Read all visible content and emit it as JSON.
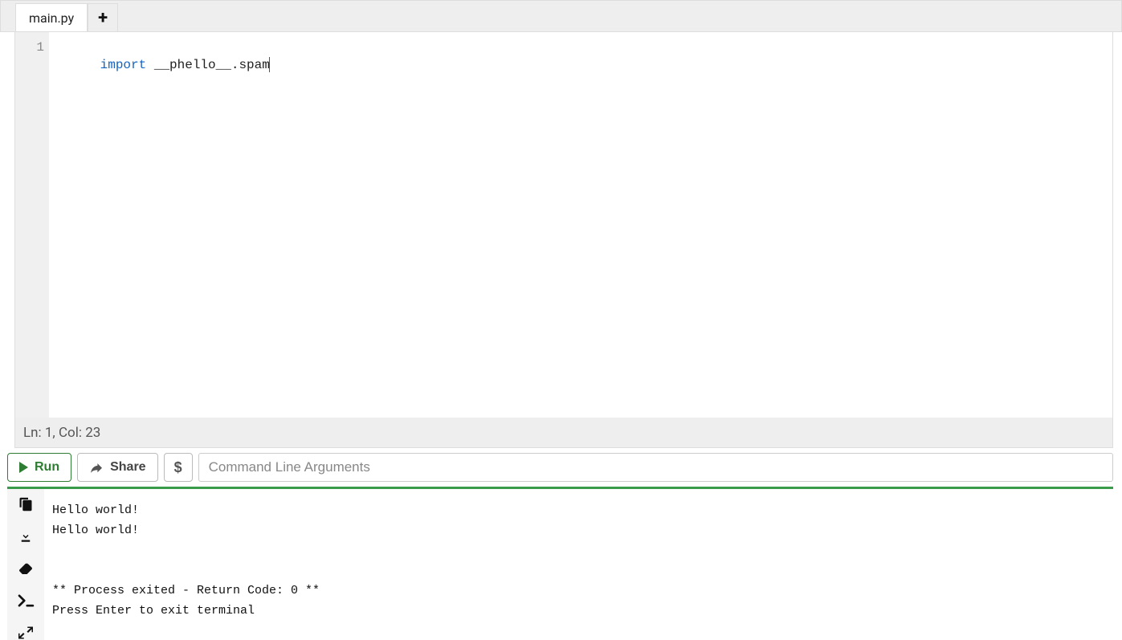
{
  "tabs": {
    "active_label": "main.py"
  },
  "editor": {
    "gutter": [
      "1"
    ],
    "line1_keyword": "import",
    "line1_rest": " __phello__.spam"
  },
  "status": {
    "text": "Ln: 1,  Col: 23"
  },
  "toolbar": {
    "run_label": "Run",
    "share_label": "Share",
    "dollar_label": "$",
    "cmd_placeholder": "Command Line Arguments"
  },
  "console": {
    "lines": [
      "Hello world!",
      "Hello world!",
      "",
      "",
      "** Process exited - Return Code: 0 **",
      "Press Enter to exit terminal"
    ]
  }
}
